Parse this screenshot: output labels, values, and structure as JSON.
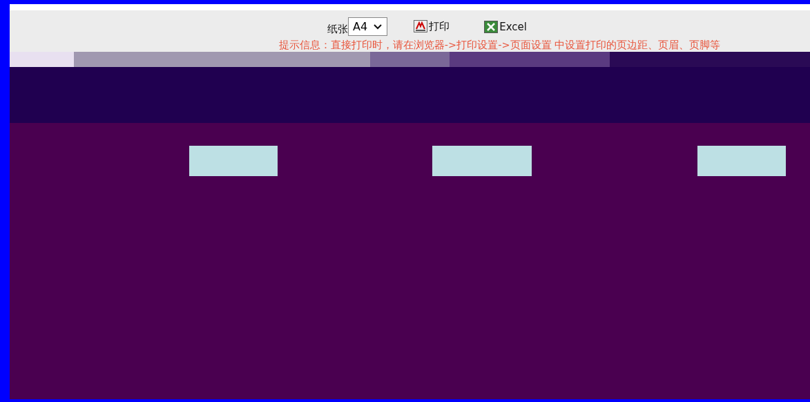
{
  "toolbar": {
    "paper_label": "纸张",
    "paper_select": {
      "value": "A4"
    },
    "print_button": "打印",
    "excel_button": "Excel"
  },
  "hint": "提示信息：直接打印时，请在浏览器->打印设置->页面设置 中设置打印的页边距、页眉、页脚等"
}
